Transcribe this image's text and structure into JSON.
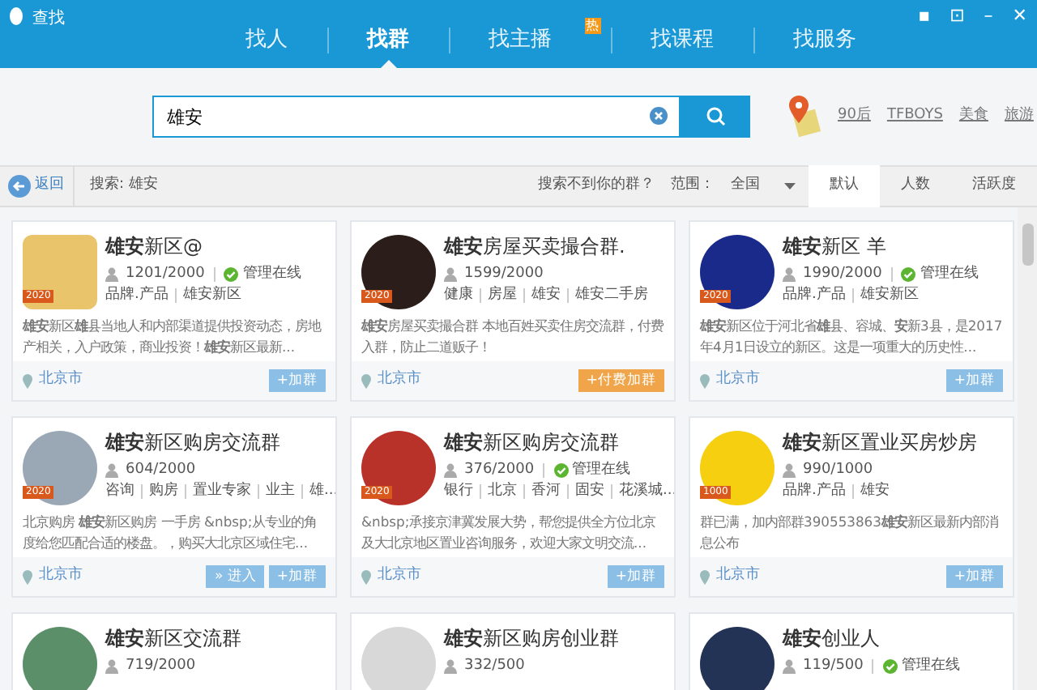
{
  "window": {
    "title": "查找",
    "controls": [
      "▪",
      "⊡",
      "–",
      "✕"
    ]
  },
  "tabs": [
    {
      "label": "找人",
      "selected": false
    },
    {
      "label": "找群",
      "selected": true
    },
    {
      "label": "找主播",
      "selected": false,
      "badge": "热"
    },
    {
      "label": "找课程",
      "selected": false
    },
    {
      "label": "找服务",
      "selected": false
    }
  ],
  "search": {
    "value": "雄安",
    "hot_keywords": [
      "90后",
      "TFBOYS",
      "美食",
      "旅游"
    ]
  },
  "toolbar": {
    "back": "返回",
    "query": "搜索: 雄安",
    "not_found": "搜索不到你的群？",
    "range_label": "范围：",
    "range_value": "全国",
    "sort_tabs": [
      {
        "label": "默认",
        "selected": true
      },
      {
        "label": "人数",
        "selected": false
      },
      {
        "label": "活跃度",
        "selected": false
      }
    ]
  },
  "groups": [
    {
      "name": "**雄安**新区@",
      "members": "1201/2000",
      "admin_online": true,
      "admin_label": "管理在线",
      "level": "2020",
      "tags": [
        "品牌.产品",
        "雄安新区"
      ],
      "description": "**雄安**新区**雄**县当地人和内部渠道提供投资动态，房地产相关，入户政策，商业投资！**雄安**新区最新...",
      "location": "北京市",
      "buttons": [
        {
          "kind": "join",
          "label": "+加群"
        }
      ]
    },
    {
      "name": "**雄安**房屋买卖撮合群.",
      "members": "1599/2000",
      "admin_online": false,
      "level": "2020",
      "tags": [
        "健康",
        "房屋",
        "雄安",
        "雄安二手房"
      ],
      "description": "**雄安**房屋买卖撮合群 本地百姓买卖住房交流群，付费入群，防止二道贩子！",
      "location": "北京市",
      "buttons": [
        {
          "kind": "paid",
          "label": "+付费加群"
        }
      ]
    },
    {
      "name": "**雄安**新区 羊",
      "members": "1990/2000",
      "admin_online": true,
      "admin_label": "管理在线",
      "level": "2020",
      "tags": [
        "品牌.产品",
        "雄安新区"
      ],
      "description": "**雄安**新区位于河北省**雄**县、容城、**安**新3县，是2017年4月1日设立的新区。这是一项重大的历史性...",
      "location": "北京市",
      "buttons": [
        {
          "kind": "join",
          "label": "+加群"
        }
      ]
    },
    {
      "name": "**雄安**新区购房交流群",
      "members": "604/2000",
      "admin_online": false,
      "level": "2020",
      "tags": [
        "咨询",
        "购房",
        "置业专家",
        "业主",
        "雄..."
      ],
      "description": "北京购房 **雄安**新区购房 一手房 &nbsp;从专业的角度给您匹配合适的楼盘。，购买大北京区域住宅...",
      "location": "北京市",
      "buttons": [
        {
          "kind": "enter",
          "label": "» 进入"
        },
        {
          "kind": "join",
          "label": "+加群"
        }
      ]
    },
    {
      "name": "**雄安**新区购房交流群",
      "members": "376/2000",
      "admin_online": true,
      "admin_label": "管理在线",
      "level": "2020",
      "tags": [
        "银行",
        "北京",
        "香河",
        "固安",
        "花溪城..."
      ],
      "description": "&nbsp;承接京津冀发展大势，帮您提供全方位北京及大北京地区置业咨询服务，欢迎大家文明交流...",
      "location": "北京市",
      "buttons": [
        {
          "kind": "join",
          "label": "+加群"
        }
      ]
    },
    {
      "name": "**雄安**新区置业买房炒房",
      "members": "990/1000",
      "admin_online": false,
      "level": "1000",
      "tags": [
        "品牌.产品",
        "雄安"
      ],
      "description": "群已满，加内部群390553863**雄安**新区最新内部消息公布",
      "location": "北京市",
      "buttons": [
        {
          "kind": "join",
          "label": "+加群"
        }
      ]
    },
    {
      "name": "**雄安**新区交流群",
      "members": "719/2000",
      "admin_online": false
    },
    {
      "name": "**雄安**新区购房创业群",
      "members": "332/500",
      "admin_online": false
    },
    {
      "name": "**雄安**创业人",
      "members": "119/500",
      "admin_online": true,
      "admin_label": "管理在线"
    }
  ]
}
